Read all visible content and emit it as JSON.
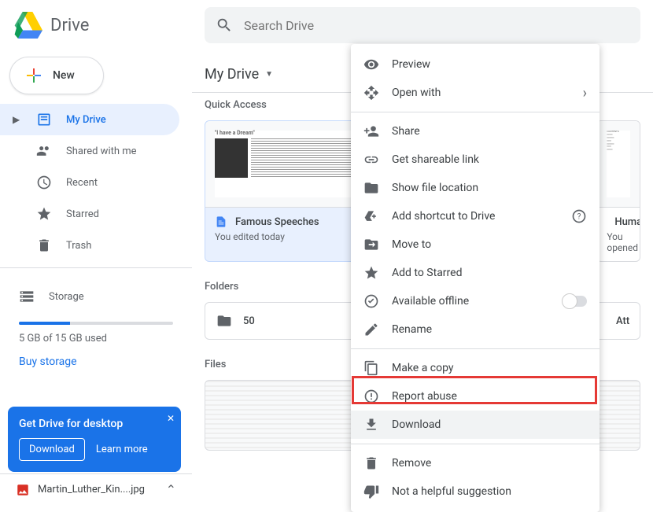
{
  "app": {
    "name": "Drive"
  },
  "search": {
    "placeholder": "Search Drive"
  },
  "sidebar": {
    "new": "New",
    "items": [
      {
        "label": "My Drive"
      },
      {
        "label": "Shared with me"
      },
      {
        "label": "Recent"
      },
      {
        "label": "Starred"
      },
      {
        "label": "Trash"
      }
    ],
    "storage_label": "Storage",
    "storage_used": "5 GB of 15 GB used",
    "buy": "Buy storage"
  },
  "promo": {
    "title": "Get Drive for desktop",
    "download": "Download",
    "learn": "Learn more"
  },
  "upload": {
    "filename": "Martin_Luther_Kin....jpg"
  },
  "main": {
    "title": "My Drive",
    "quick_access": "Quick Access",
    "folders_label": "Folders",
    "files_label": "Files",
    "cards": [
      {
        "title": "Famous Speeches",
        "sub": "You edited today",
        "preview_title": "\"I have a Dream\""
      },
      {
        "title": "Huma",
        "sub": "You opened"
      }
    ],
    "folders": [
      {
        "name": "50"
      },
      {
        "name": "Att"
      }
    ]
  },
  "context_menu": {
    "preview": "Preview",
    "open_with": "Open with",
    "share": "Share",
    "get_link": "Get shareable link",
    "show_location": "Show file location",
    "add_shortcut": "Add shortcut to Drive",
    "move_to": "Move to",
    "star": "Add to Starred",
    "offline": "Available offline",
    "rename": "Rename",
    "copy": "Make a copy",
    "report": "Report abuse",
    "download": "Download",
    "remove": "Remove",
    "not_helpful": "Not a helpful suggestion"
  }
}
